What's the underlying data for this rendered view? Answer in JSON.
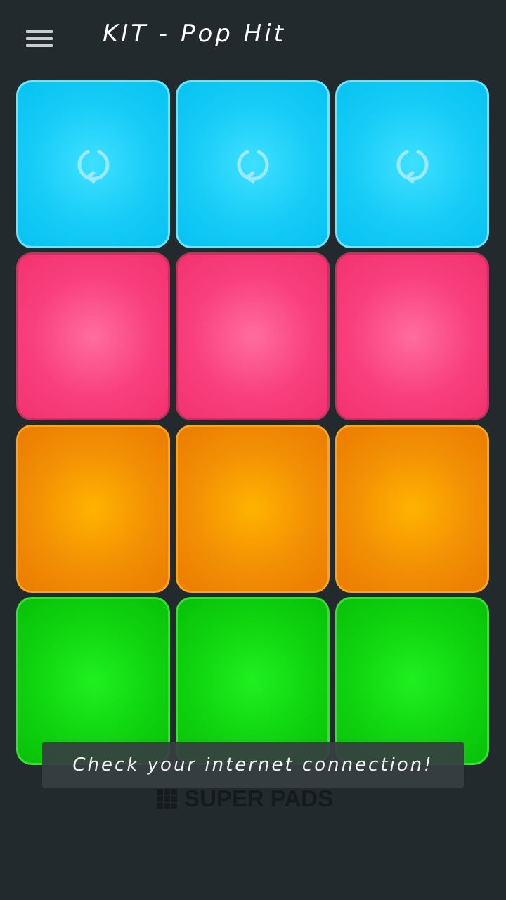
{
  "header": {
    "title": "KIT - Pop Hit",
    "menu_icon": "hamburger-menu-icon"
  },
  "pads": [
    {
      "row": 1,
      "col": 1,
      "color": "cyan",
      "hex": "#17ccf7",
      "icon": "loop-icon"
    },
    {
      "row": 1,
      "col": 2,
      "color": "cyan",
      "hex": "#17ccf7",
      "icon": "loop-icon"
    },
    {
      "row": 1,
      "col": 3,
      "color": "cyan",
      "hex": "#17ccf7",
      "icon": "loop-icon"
    },
    {
      "row": 2,
      "col": 1,
      "color": "pink",
      "hex": "#f93f7e",
      "icon": ""
    },
    {
      "row": 2,
      "col": 2,
      "color": "pink",
      "hex": "#f93f7e",
      "icon": ""
    },
    {
      "row": 2,
      "col": 3,
      "color": "pink",
      "hex": "#f93f7e",
      "icon": ""
    },
    {
      "row": 3,
      "col": 1,
      "color": "orange",
      "hex": "#f28f04",
      "icon": ""
    },
    {
      "row": 3,
      "col": 2,
      "color": "orange",
      "hex": "#f28f04",
      "icon": ""
    },
    {
      "row": 3,
      "col": 3,
      "color": "orange",
      "hex": "#f28f04",
      "icon": ""
    },
    {
      "row": 4,
      "col": 1,
      "color": "green",
      "hex": "#0fd40f",
      "icon": ""
    },
    {
      "row": 4,
      "col": 2,
      "color": "green",
      "hex": "#0fd40f",
      "icon": ""
    },
    {
      "row": 4,
      "col": 3,
      "color": "green",
      "hex": "#0fd40f",
      "icon": ""
    }
  ],
  "toast": {
    "message": "Check your internet connection!"
  },
  "brand": {
    "name": "SUPER PADS",
    "icon": "grid-logo-icon"
  },
  "colors": {
    "background": "#232a2e",
    "cyan": "#17ccf7",
    "pink": "#f93f7e",
    "orange": "#f28f04",
    "green": "#0fd40f"
  }
}
